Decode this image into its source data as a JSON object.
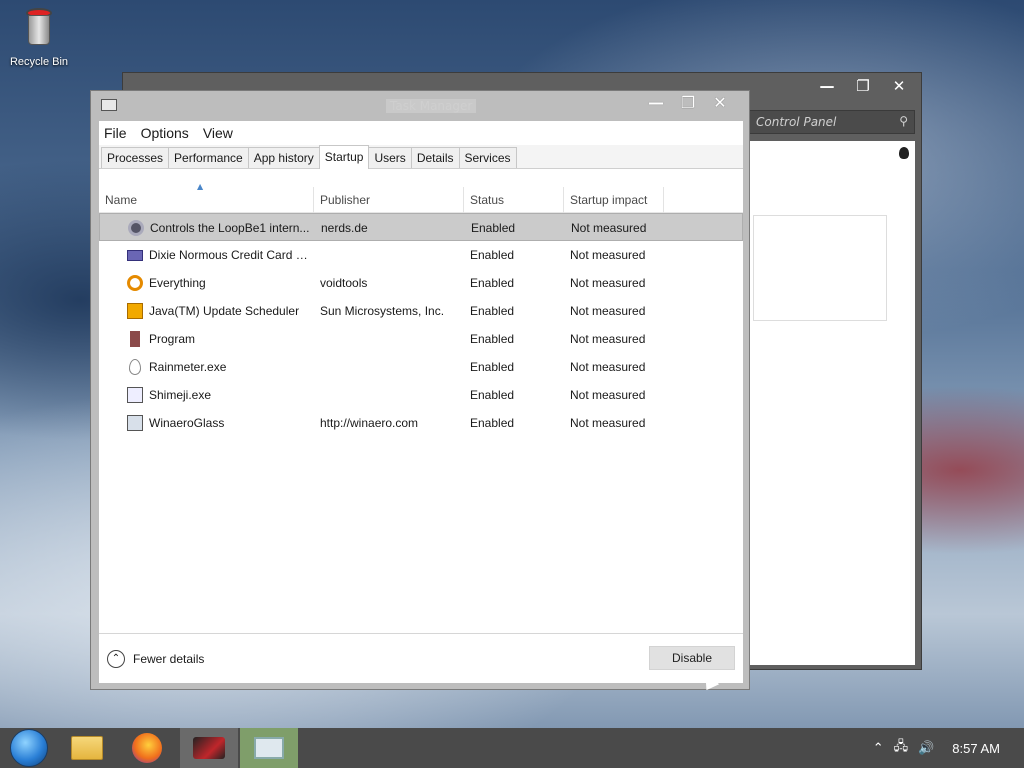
{
  "desktop": {
    "recycle_bin_label": "Recycle Bin"
  },
  "control_panel": {
    "search_placeholder": "Control Panel",
    "controls": {
      "minimize": "—",
      "maximize": "❐",
      "close": "✕"
    }
  },
  "task_manager": {
    "title": "Task Manager",
    "controls": {
      "minimize": "—",
      "maximize": "❐",
      "close": "✕"
    },
    "menu": [
      "File",
      "Options",
      "View"
    ],
    "tabs": [
      "Processes",
      "Performance",
      "App history",
      "Startup",
      "Users",
      "Details",
      "Services"
    ],
    "active_tab": "Startup",
    "columns": {
      "name": "Name",
      "publisher": "Publisher",
      "status": "Status",
      "impact": "Startup impact"
    },
    "rows": [
      {
        "name": "Controls the LoopBe1 intern...",
        "publisher": "nerds.de",
        "status": "Enabled",
        "impact": "Not measured",
        "icon": "loopbe-icon"
      },
      {
        "name": "Dixie Normous Credit Card S...",
        "publisher": "",
        "status": "Enabled",
        "impact": "Not measured",
        "icon": "credit-card-icon"
      },
      {
        "name": "Everything",
        "publisher": "voidtools",
        "status": "Enabled",
        "impact": "Not measured",
        "icon": "magnifier-icon"
      },
      {
        "name": "Java(TM) Update Scheduler",
        "publisher": "Sun Microsystems, Inc.",
        "status": "Enabled",
        "impact": "Not measured",
        "icon": "java-icon"
      },
      {
        "name": "Program",
        "publisher": "",
        "status": "Enabled",
        "impact": "Not measured",
        "icon": "program-icon"
      },
      {
        "name": "Rainmeter.exe",
        "publisher": "",
        "status": "Enabled",
        "impact": "Not measured",
        "icon": "droplet-icon"
      },
      {
        "name": "Shimeji.exe",
        "publisher": "",
        "status": "Enabled",
        "impact": "Not measured",
        "icon": "shimeji-icon"
      },
      {
        "name": "WinaeroGlass",
        "publisher": "http://winaero.com",
        "status": "Enabled",
        "impact": "Not measured",
        "icon": "window-icon"
      }
    ],
    "footer": {
      "fewer_details": "Fewer details",
      "disable": "Disable"
    }
  },
  "taskbar": {
    "clock": "8:57 AM",
    "apps": [
      "start-orb-icon",
      "file-explorer-icon",
      "firefox-icon",
      "red-app-icon",
      "task-manager-icon"
    ]
  }
}
